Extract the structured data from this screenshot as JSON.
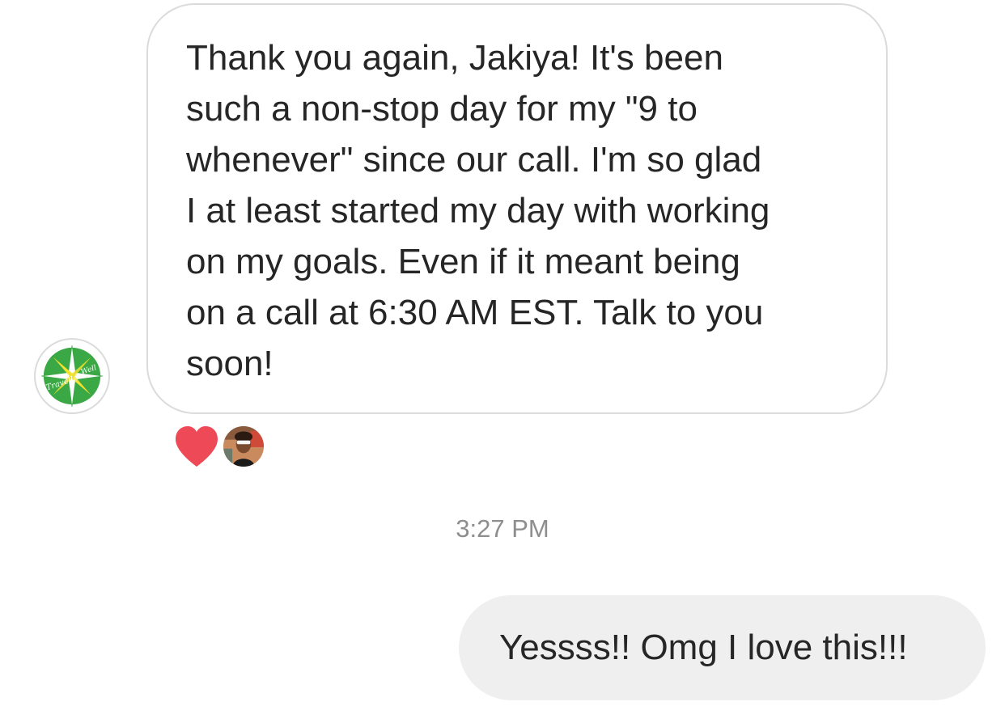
{
  "conversation": {
    "incoming_message": {
      "text": "Thank you again, Jakiya! It's been\nsuch a non-stop day for my \"9 to\nwhenever\" since our call. I'm so glad\nI at least started my day with working\non my goals. Even if it meant being\non a call at 6:30 AM EST. Talk to you\nsoon!",
      "sender_avatar_logo_text": [
        "Travelle",
        "Well"
      ],
      "reaction": {
        "icon": "heart-icon",
        "color": "#ed4956",
        "reactor_avatar": "user-photo"
      }
    },
    "timestamp": "3:27 PM",
    "outgoing_message": {
      "text": "Yessss!! Omg I love this!!!",
      "bubble_color": "#efefef"
    }
  }
}
